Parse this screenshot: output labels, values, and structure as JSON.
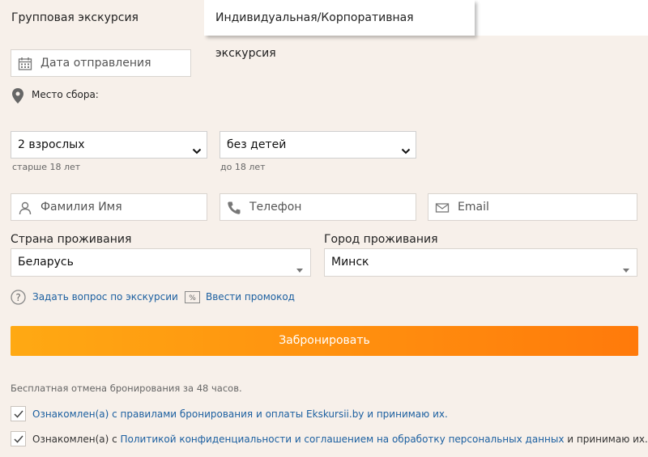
{
  "tabs": {
    "group": "Групповая экскурсия",
    "individual": "Индивидуальная/Корпоративная экскурсия"
  },
  "form": {
    "date_placeholder": "Дата отправления",
    "meeting_point_label": "Место сбора:",
    "adults_select": "2 взрослых",
    "adults_hint": "старше 18 лет",
    "children_select": "без детей",
    "children_hint": "до 18 лет",
    "name_placeholder": "Фамилия Имя",
    "phone_placeholder": "Телефон",
    "email_placeholder": "Email",
    "country_label": "Страна проживания",
    "country_value": "Беларусь",
    "city_label": "Город проживания",
    "city_value": "Минск",
    "ask_question_link": "Задать вопрос по экскурсии",
    "promo_link": "Ввести промокод",
    "book_button": "Забронировать",
    "free_cancel_note": "Бесплатная отмена бронирования за 48 часов.",
    "agree1_prefix": "Ознакомлен(а) с правилами бронирования и оплаты Ekskursii.by и принимаю их.",
    "agree2_prefix": "Ознакомлен(а) с ",
    "agree2_link": "Политикой конфиденциальности и соглашением на обработку персональных данных",
    "agree2_suffix": " и принимаю их."
  },
  "colors": {
    "background": "#f7f0ea",
    "accent_start": "#ffa913",
    "accent_end": "#ff7a0b",
    "link": "#1b5fa0"
  },
  "icons": [
    "calendar-icon",
    "location-pin-icon",
    "chevron-down-icon",
    "person-icon",
    "phone-icon",
    "mail-icon",
    "question-icon",
    "percent-icon",
    "check-icon"
  ]
}
